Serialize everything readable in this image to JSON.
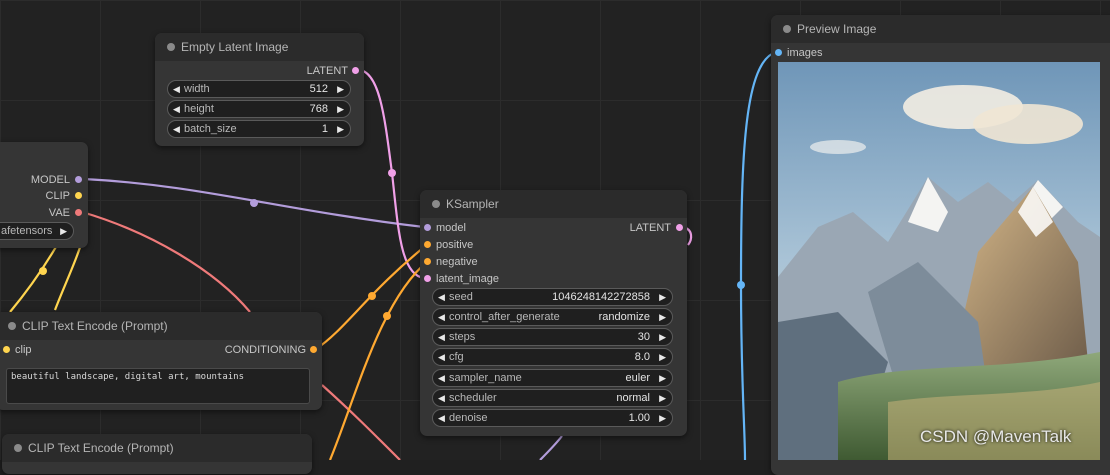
{
  "colors": {
    "model": "#b39ddb",
    "clip": "#ffd54f",
    "vae": "#ef7a7a",
    "latent": "#f0a0e8",
    "conditioning": "#ffa931",
    "image": "#64b5f6"
  },
  "empty_latent": {
    "title": "Empty Latent Image",
    "output": "LATENT",
    "widgets": [
      {
        "label": "width",
        "value": "512"
      },
      {
        "label": "height",
        "value": "768"
      },
      {
        "label": "batch_size",
        "value": "1"
      }
    ]
  },
  "checkpoint": {
    "outputs": [
      "MODEL",
      "CLIP",
      "VAE"
    ],
    "widget_text": "afetensors"
  },
  "ksampler": {
    "title": "KSampler",
    "inputs": [
      "model",
      "positive",
      "negative",
      "latent_image"
    ],
    "output": "LATENT",
    "widgets": [
      {
        "label": "seed",
        "value": "1046248142272858"
      },
      {
        "label": "control_after_generate",
        "value": "randomize"
      },
      {
        "label": "steps",
        "value": "30"
      },
      {
        "label": "cfg",
        "value": "8.0"
      },
      {
        "label": "sampler_name",
        "value": "euler"
      },
      {
        "label": "scheduler",
        "value": "normal"
      },
      {
        "label": "denoise",
        "value": "1.00"
      }
    ]
  },
  "clip_encode_1": {
    "title": "CLIP Text Encode (Prompt)",
    "input": "clip",
    "output": "CONDITIONING",
    "text": "beautiful landscape, digital art, mountains"
  },
  "clip_encode_2": {
    "title": "CLIP Text Encode (Prompt)"
  },
  "preview": {
    "title": "Preview Image",
    "input": "images"
  },
  "watermark": "CSDN @MavenTalk"
}
